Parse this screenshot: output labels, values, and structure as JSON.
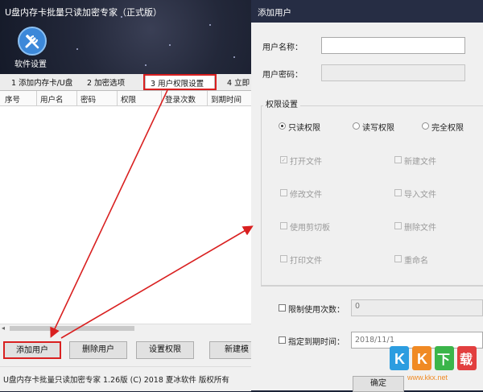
{
  "app": {
    "title": "U盘内存卡批量只读加密专家（正式版）",
    "settings_label": "软件设置"
  },
  "tabs": [
    {
      "label": "1 添加内存卡/U盘"
    },
    {
      "label": "2 加密选项"
    },
    {
      "label": "3 用户权限设置"
    },
    {
      "label": "4 立即"
    }
  ],
  "table": {
    "columns": [
      "序号",
      "用户名",
      "密码",
      "权限",
      "登录次数",
      "到期时间"
    ]
  },
  "buttons": {
    "add": "添加用户",
    "delete": "删除用户",
    "set_perm": "设置权限",
    "new": "新建模"
  },
  "status": "U盘内存卡批量只读加密专家 1.26版 (C) 2018 夏冰软件 版权所有",
  "dialog": {
    "title": "添加用户",
    "username_label": "用户名称：",
    "username_value": "",
    "password_label": "用户密码：",
    "perm_group": "权限设置",
    "radios": [
      "只读权限",
      "读写权限",
      "完全权限"
    ],
    "checkboxes": {
      "open": "打开文件",
      "new": "新建文件",
      "modify": "修改文件",
      "import": "导入文件",
      "clipboard": "使用剪切板",
      "delete": "删除文件",
      "print": "打印文件",
      "rename": "重命名"
    },
    "limit_label": "限制使用次数：",
    "limit_value": "0",
    "expire_label": "指定到期时间：",
    "expire_date": "2018/11/",
    "expire_day": "1",
    "ok": "确定"
  },
  "watermark": {
    "brand": "KK下载",
    "url": "www.kkx.net"
  },
  "colors": {
    "highlight": "#d92020",
    "title_bg": "#262d44",
    "icon_blue": "#3c88d9"
  }
}
